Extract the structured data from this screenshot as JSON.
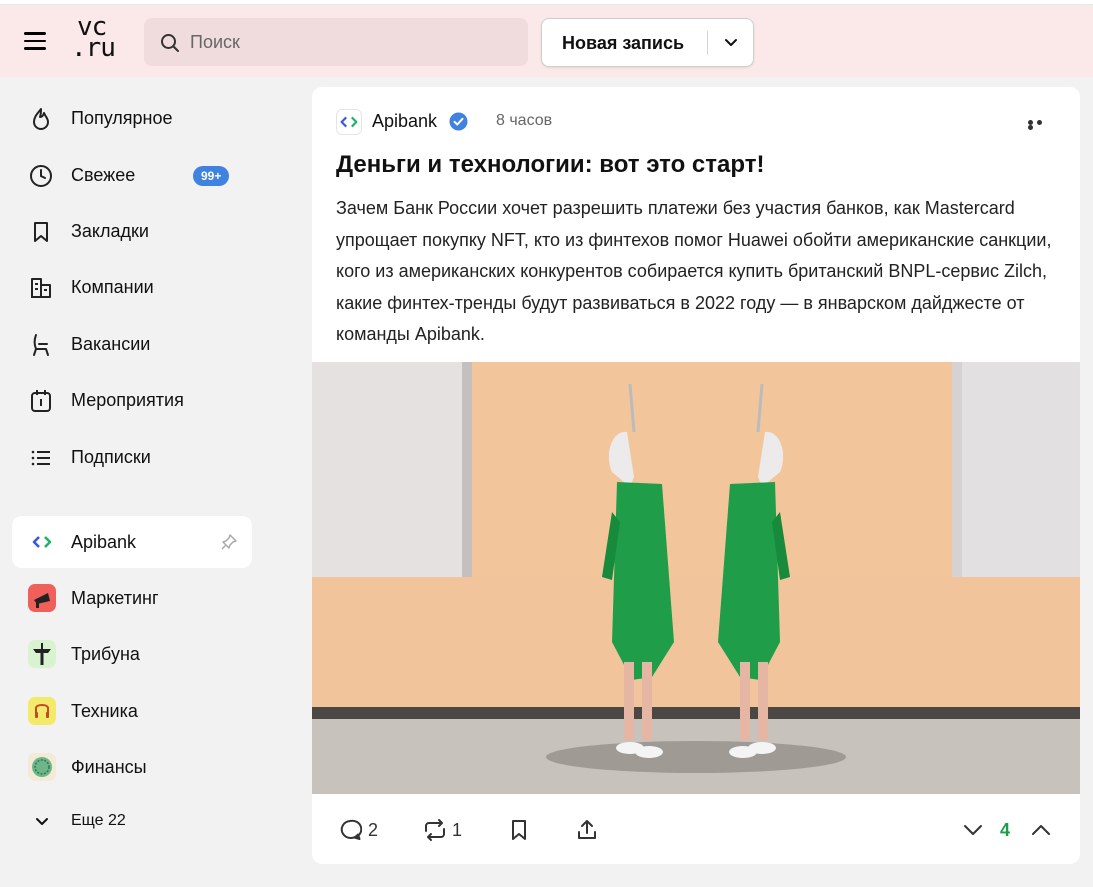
{
  "header": {
    "logo_line1": "vc",
    "logo_line2": ".ru",
    "search_placeholder": "Поиск",
    "new_post_label": "Новая запись"
  },
  "sidebar": {
    "items": [
      {
        "label": "Популярное",
        "icon": "flame-icon"
      },
      {
        "label": "Свежее",
        "icon": "clock-icon",
        "badge": "99+"
      },
      {
        "label": "Закладки",
        "icon": "bookmark-icon"
      },
      {
        "label": "Компании",
        "icon": "buildings-icon"
      },
      {
        "label": "Вакансии",
        "icon": "chair-icon"
      },
      {
        "label": "Мероприятия",
        "icon": "calendar-icon"
      },
      {
        "label": "Подписки",
        "icon": "list-icon"
      }
    ],
    "subscriptions": [
      {
        "label": "Apibank",
        "active": true,
        "icon": "apibank-logo-icon"
      },
      {
        "label": "Маркетинг",
        "icon": "megaphone-icon"
      },
      {
        "label": "Трибуна",
        "icon": "tribune-icon"
      },
      {
        "label": "Техника",
        "icon": "headphones-icon"
      },
      {
        "label": "Финансы",
        "icon": "coin-icon"
      }
    ],
    "more_label": "Еще 22"
  },
  "post": {
    "author": "Apibank",
    "time": "8 часов",
    "title": "Деньги и технологии: вот это старт!",
    "description": "Зачем Банк России хочет разрешить платежи без участия банков, как Mastercard упрощает покупку NFT, кто из финтехов помог Huawei обойти американские санкции, кого из американских конкурентов собирается купить британский BNPL-сервис Zilch, какие финтех-тренды будут развиваться в 2022 году — в январском дайджесте от команды Apibank.",
    "comments": "2",
    "reposts": "1",
    "rating": "4"
  },
  "colors": {
    "header_bg": "#fbe8e9",
    "badge": "#3f82e0",
    "rating_green": "#1a9e4b",
    "dress_green": "#1f9d48"
  }
}
